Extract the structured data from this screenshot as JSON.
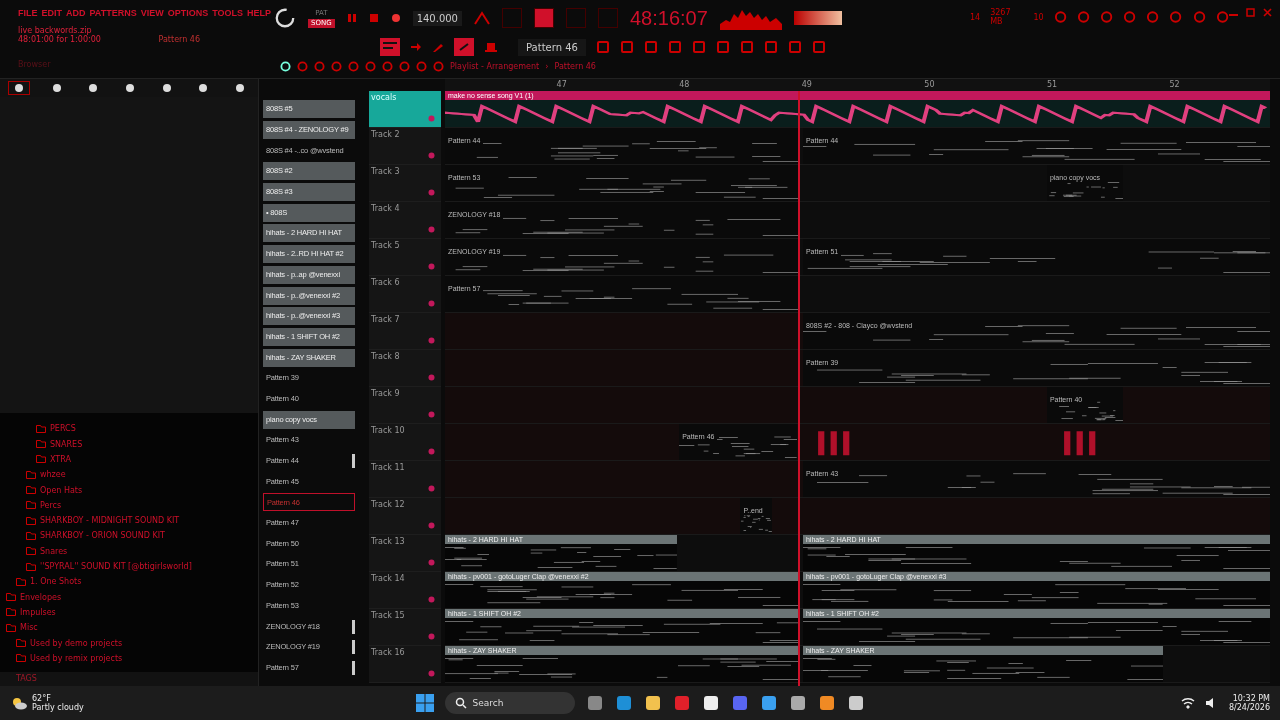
{
  "menu": [
    "FILE",
    "EDIT",
    "ADD",
    "PATTERNS",
    "VIEW",
    "OPTIONS",
    "TOOLS",
    "HELP"
  ],
  "project": {
    "file": "live backwords.zip",
    "range": "48:01:00 for 1:00:00",
    "pattern": "Pattern 46"
  },
  "transport": {
    "modes": [
      {
        "label": "PAT",
        "selected": false
      },
      {
        "label": "SONG",
        "selected": true
      }
    ],
    "tempo": "140.000",
    "time": "48:16:07",
    "memory": "3267 MB",
    "cpu": "10",
    "polyphony": "14"
  },
  "pattern_selector": "Pattern 46",
  "browser": {
    "label": "Browser",
    "tags": "TAGS",
    "tabs": [
      {
        "selected": true
      },
      {
        "selected": false
      },
      {
        "selected": false
      },
      {
        "selected": false
      },
      {
        "selected": false
      },
      {
        "selected": false
      },
      {
        "selected": false
      }
    ],
    "tree": [
      {
        "children": [
          {
            "children": [
              {
                "children": [
                  {
                    "label": "PERCS"
                  },
                  {
                    "label": "SNARES"
                  },
                  {
                    "label": "XTRA"
                  }
                ]
              },
              {
                "label": "whzee"
              },
              {
                "label": "Open Hats"
              },
              {
                "label": "Percs"
              },
              {
                "label": "SHARKBOY - MIDNIGHT SOUND KIT"
              },
              {
                "label": "SHARKBOY - ORION SOUND KIT"
              },
              {
                "label": "Snares"
              },
              {
                "label": "''SPYRAL'' SOUND KIT [@btigirlsworld]"
              }
            ]
          },
          {
            "label": "1. One Shots"
          }
        ]
      },
      {
        "label": "Envelopes"
      },
      {
        "label": "Impulses"
      },
      {
        "label": "Misc",
        "children": [
          {
            "label": "Used by demo projects"
          },
          {
            "label": "Used by remix projects"
          }
        ]
      }
    ]
  },
  "patterns": [
    {
      "label": "808S #5",
      "kind": "filled",
      "selected": false,
      "marked": false
    },
    {
      "label": "808S #4 - ZENOLOGY #9",
      "kind": "filled",
      "selected": false,
      "marked": false
    },
    {
      "label": "808S #4 -..co @wvstend",
      "kind": "plain",
      "selected": false,
      "marked": false
    },
    {
      "label": "808S #2",
      "kind": "filled",
      "selected": false,
      "marked": false
    },
    {
      "label": "808S #3",
      "kind": "filled",
      "selected": false,
      "marked": false
    },
    {
      "label": "• 808S",
      "kind": "filled",
      "selected": false,
      "marked": false
    },
    {
      "label": "hihats - 2 HARD HI HAT",
      "kind": "filled",
      "selected": false,
      "marked": false
    },
    {
      "label": "hihats - 2..RD HI HAT #2",
      "kind": "filled",
      "selected": false,
      "marked": false
    },
    {
      "label": "hihats - p..ap @venexxi",
      "kind": "filled",
      "selected": false,
      "marked": false
    },
    {
      "label": "hihats - p..@venexxi #2",
      "kind": "filled",
      "selected": false,
      "marked": false
    },
    {
      "label": "hihats - p..@venexxi #3",
      "kind": "filled",
      "selected": false,
      "marked": false
    },
    {
      "label": "hihats - 1 SHIFT OH #2",
      "kind": "filled",
      "selected": false,
      "marked": false
    },
    {
      "label": "hihats - ZAY SHAKER",
      "kind": "filled",
      "selected": false,
      "marked": false
    },
    {
      "label": "Pattern 39",
      "kind": "plain",
      "selected": false,
      "marked": false
    },
    {
      "label": "Pattern 40",
      "kind": "plain",
      "selected": false,
      "marked": false
    },
    {
      "label": "piano copy vocs",
      "kind": "filled",
      "selected": false,
      "marked": false
    },
    {
      "label": "Pattern 43",
      "kind": "plain",
      "selected": false,
      "marked": false
    },
    {
      "label": "Pattern 44",
      "kind": "plain",
      "selected": false,
      "marked": true
    },
    {
      "label": "Pattern 45",
      "kind": "plain",
      "selected": false,
      "marked": false
    },
    {
      "label": "Pattern 46",
      "kind": "plain",
      "selected": true,
      "marked": false
    },
    {
      "label": "Pattern 47",
      "kind": "plain",
      "selected": false,
      "marked": false
    },
    {
      "label": "Pattern 50",
      "kind": "plain",
      "selected": false,
      "marked": false
    },
    {
      "label": "Pattern 51",
      "kind": "plain",
      "selected": false,
      "marked": false
    },
    {
      "label": "Pattern 52",
      "kind": "plain",
      "selected": false,
      "marked": false
    },
    {
      "label": "Pattern 53",
      "kind": "plain",
      "selected": false,
      "marked": false
    },
    {
      "label": "ZENOLOGY #18",
      "kind": "plain",
      "selected": false,
      "marked": true
    },
    {
      "label": "ZENOLOGY #19",
      "kind": "plain",
      "selected": false,
      "marked": true
    },
    {
      "label": "Pattern 57",
      "kind": "plain",
      "selected": false,
      "marked": true
    }
  ],
  "playlist": {
    "title": "Playlist - Arrangement",
    "separator": "›",
    "pattern": "Pattern 46",
    "ruler": [
      "47",
      "48",
      "49",
      "50",
      "51",
      "52"
    ],
    "tracks": [
      {
        "name": "vocals",
        "selected": true,
        "clips": [
          {
            "kind": "audio",
            "label": "make no sense song V1 (1)"
          }
        ]
      },
      {
        "name": "Track 2",
        "selected": false,
        "clips": [
          {
            "kind": "plain",
            "label": "Pattern 44"
          },
          {
            "kind": "plain",
            "label": "Pattern 44"
          }
        ]
      },
      {
        "name": "Track 3",
        "selected": false,
        "clips": [
          {
            "kind": "plain",
            "label": "Pattern 53"
          },
          {
            "kind": "plain",
            "label": "piano copy vocs"
          }
        ]
      },
      {
        "name": "Track 4",
        "selected": false,
        "clips": [
          {
            "kind": "plain",
            "label": "ZENOLOGY #18"
          }
        ]
      },
      {
        "name": "Track 5",
        "selected": false,
        "clips": [
          {
            "kind": "plain",
            "label": "ZENOLOGY #19"
          },
          {
            "kind": "plain",
            "label": "Pattern 51"
          }
        ]
      },
      {
        "name": "Track 6",
        "selected": false,
        "clips": [
          {
            "kind": "plain",
            "label": "Pattern 57"
          }
        ]
      },
      {
        "name": "Track 7",
        "selected": false,
        "clips": [
          {
            "kind": "plain",
            "label": "808S #2 - 808 - Clayco @wvstend"
          }
        ]
      },
      {
        "name": "Track 8",
        "selected": false,
        "clips": [
          {
            "kind": "plain",
            "label": "Pattern 39"
          }
        ]
      },
      {
        "name": "Track 9",
        "selected": false,
        "clips": [
          {
            "kind": "plain",
            "label": "Pattern 40"
          }
        ]
      },
      {
        "name": "Track 10",
        "selected": false,
        "clips": [
          {
            "kind": "plain",
            "label": "Pattern 46"
          },
          {
            "kind": "red"
          },
          {
            "kind": "red"
          }
        ]
      },
      {
        "name": "Track 11",
        "selected": false,
        "clips": [
          {
            "kind": "plain",
            "label": "Pattern 43"
          }
        ]
      },
      {
        "name": "Track 12",
        "selected": false,
        "clips": [
          {
            "kind": "plain",
            "label": "P..end"
          }
        ]
      },
      {
        "name": "Track 13",
        "selected": false,
        "clips": [
          {
            "kind": "filled",
            "label": "hihats - 2 HARD HI HAT"
          },
          {
            "kind": "filled",
            "label": "hihats - 2 HARD HI HAT"
          }
        ]
      },
      {
        "name": "Track 14",
        "selected": false,
        "clips": [
          {
            "kind": "filled",
            "label": "hihats - pv001 - gotoLuger Clap @venexxi #2"
          },
          {
            "kind": "filled",
            "label": "hihats - pv001 - gotoLuger Clap @venexxi #3"
          }
        ]
      },
      {
        "name": "Track 15",
        "selected": false,
        "clips": [
          {
            "kind": "filled",
            "label": "hihats - 1 SHIFT OH #2"
          },
          {
            "kind": "filled",
            "label": "hihats - 1 SHIFT OH #2"
          }
        ]
      },
      {
        "name": "Track 16",
        "selected": false,
        "clips": [
          {
            "kind": "filled",
            "label": "hihats - ZAY SHAKER"
          },
          {
            "kind": "filled",
            "label": "hihats - ZAY SHAKER"
          }
        ]
      }
    ]
  },
  "taskbar": {
    "temperature": "62°F",
    "weather": "Partly cloudy",
    "search": "Search",
    "time": "10:32 PM",
    "date": "8/24/2026"
  }
}
